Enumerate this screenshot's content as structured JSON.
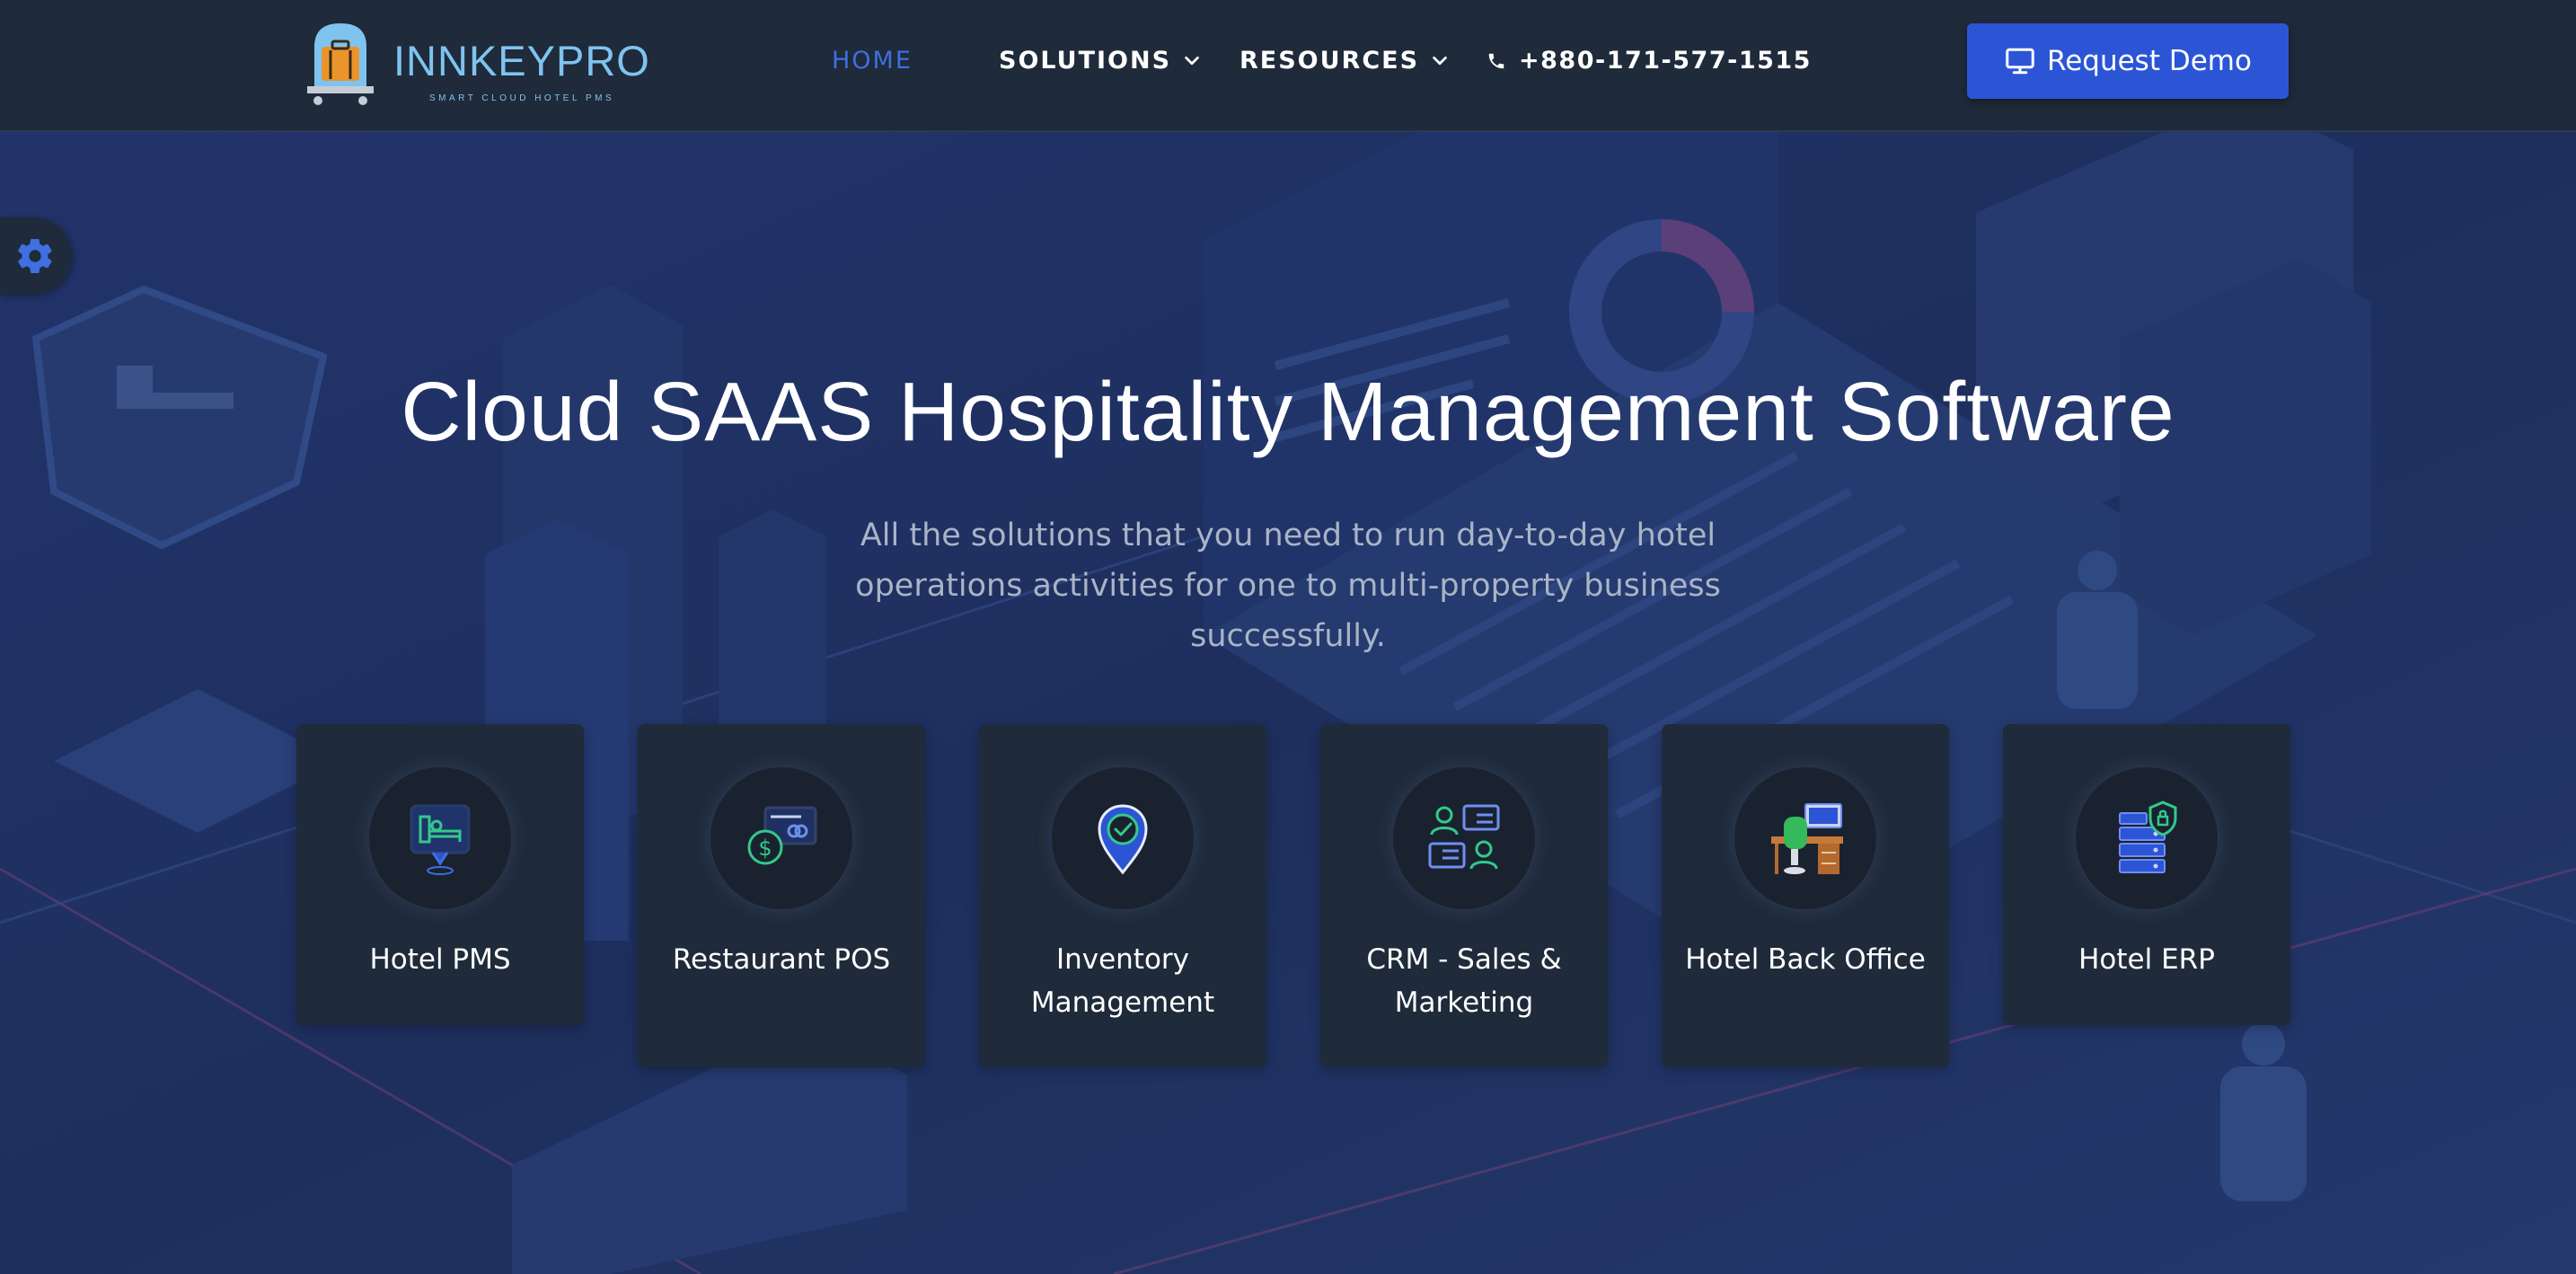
{
  "brand": {
    "name": "INNKEYPRO",
    "tagline": "SMART CLOUD HOTEL PMS"
  },
  "nav": {
    "home": "HOME",
    "solutions": "SOLUTIONS",
    "resources": "RESOURCES",
    "phone": "+880-171-577-1515"
  },
  "header_button": {
    "label": "Request Demo"
  },
  "hero": {
    "title": "Cloud SAAS Hospitality Management Software",
    "subtitle": "All the solutions that you need to run day-to-day hotel operations activities for one to multi-property business successfully."
  },
  "solutions": [
    {
      "label": "Hotel PMS",
      "icon": "hotel-bed-pin-icon"
    },
    {
      "label": "Restaurant POS",
      "icon": "payment-card-icon"
    },
    {
      "label": "Inventory Management",
      "icon": "location-check-icon"
    },
    {
      "label": "CRM - Sales & Marketing",
      "icon": "contacts-icon"
    },
    {
      "label": "Hotel Back Office",
      "icon": "office-desk-icon"
    },
    {
      "label": "Hotel ERP",
      "icon": "server-shield-icon"
    }
  ],
  "colors": {
    "header_bg": "#1f2a3a",
    "hero_bg": "#1d2d57",
    "accent": "#2c55d6",
    "nav_active": "#3f6fe0",
    "card_bg": "#1f2a3a",
    "logo": "#7fc3ef"
  }
}
